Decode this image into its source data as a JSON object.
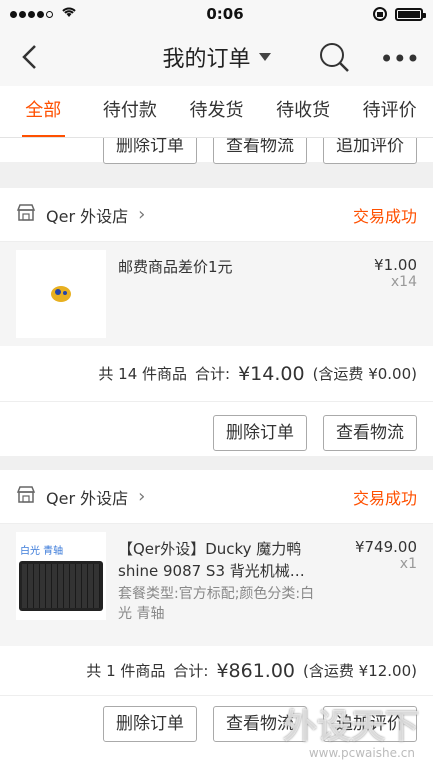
{
  "status": {
    "time": "0:06"
  },
  "nav": {
    "title": "我的订单"
  },
  "tabs": [
    "全部",
    "待付款",
    "待发货",
    "待收货",
    "待评价"
  ],
  "top_actions": [
    "删除订单",
    "查看物流",
    "追加评价"
  ],
  "orders": [
    {
      "shop": "Qer 外设店",
      "status": "交易成功",
      "item": {
        "title": "邮费商品差价1元",
        "price": "¥1.00",
        "qty": "x14"
      },
      "summary": {
        "count": "共 14 件商品",
        "total_label": "合计:",
        "total": "¥14.00",
        "shipping": "(含运费 ¥0.00)"
      },
      "actions": [
        "删除订单",
        "查看物流"
      ]
    },
    {
      "shop": "Qer 外设店",
      "status": "交易成功",
      "item": {
        "title": "【Qer外设】Ducky 魔力鸭 shine 9087 S3 背光机械…",
        "sku": "套餐类型:官方标配;颜色分类:白光 青轴",
        "price": "¥749.00",
        "qty": "x1",
        "thumb_tag": "白光 青轴"
      },
      "summary": {
        "count": "共 1 件商品",
        "total_label": "合计:",
        "total": "¥861.00",
        "shipping": "(含运费 ¥12.00)"
      },
      "actions": [
        "删除订单",
        "查看物流",
        "追加评价"
      ]
    }
  ],
  "watermark": {
    "text": "外设天下",
    "url": "www.pcwaishe.cn"
  },
  "colors": {
    "accent": "#ff5000",
    "background": "#f0f0f0"
  }
}
